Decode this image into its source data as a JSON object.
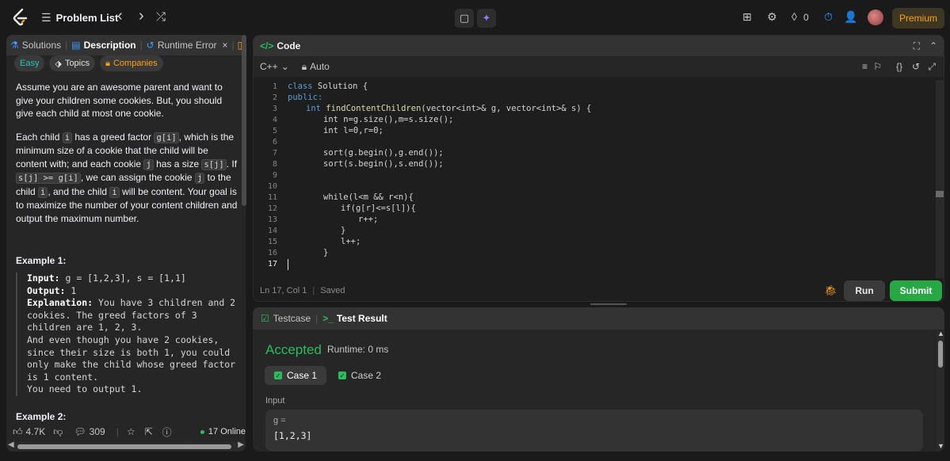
{
  "topbar": {
    "problem_list": "Problem List",
    "prev": "‹",
    "next": "›",
    "shuffle": "⤮",
    "streak_count": "0",
    "premium": "Premium"
  },
  "left": {
    "tabs": {
      "solutions": "Solutions",
      "description": "Description",
      "runtime_error": "Runtime Error",
      "close": "×"
    },
    "tags": {
      "difficulty": "Easy",
      "topics": "Topics",
      "companies": "Companies"
    },
    "desc_p1": "Assume you are an awesome parent and want to give your children some cookies. But, you should give each child at most one cookie.",
    "desc_p2": {
      "t1": "Each child ",
      "c1": "i",
      "t2": " has a greed factor ",
      "c2": "g[i]",
      "t3": ", which is the minimum size of a cookie that the child will be content with; and each cookie ",
      "c3": "j",
      "t4": " has a size ",
      "c4": "s[j]",
      "t5": ". If ",
      "c5": "s[j] >= g[i]",
      "t6": ", we can assign the cookie ",
      "c6": "j",
      "t7": " to the child ",
      "c7": "i",
      "t8": ", and the child ",
      "c8": "i",
      "t9": " will be content. Your goal is to maximize the number of your content children and output the maximum number."
    },
    "example1_title": "Example 1:",
    "example1": {
      "input_label": "Input:",
      "input_value": " g = [1,2,3], s = [1,1]",
      "output_label": "Output:",
      "output_value": " 1",
      "explanation_label": "Explanation:",
      "explanation_value": " You have 3 children and 2 cookies. The greed factors of 3 children are 1, 2, 3.\nAnd even though you have 2 cookies, since their size is both 1, you could only make the child whose greed factor is 1 content.\nYou need to output 1."
    },
    "example2_title": "Example 2:",
    "footer": {
      "likes": "4.7K",
      "comments": "309",
      "online": "17 Online"
    }
  },
  "code": {
    "title": "Code",
    "language": "C++",
    "mode": "Auto",
    "lines": [
      {
        "n": "1"
      },
      {
        "n": "2"
      },
      {
        "n": "3"
      },
      {
        "n": "4"
      },
      {
        "n": "5"
      },
      {
        "n": "6"
      },
      {
        "n": "7"
      },
      {
        "n": "8"
      },
      {
        "n": "9"
      },
      {
        "n": "10"
      },
      {
        "n": "11"
      },
      {
        "n": "12"
      },
      {
        "n": "13"
      },
      {
        "n": "14"
      },
      {
        "n": "15"
      },
      {
        "n": "16"
      },
      {
        "n": "17"
      }
    ],
    "code_text": {
      "l1_kw": "class",
      "l1_rest": " Solution {",
      "l2": "public:",
      "l3_kw": "int",
      "l3_fn": " findContentChildren",
      "l3_rest": "(vector<int>& g, vector<int>& s) {",
      "l4": "int n=g.size(),m=s.size();",
      "l5": "int l=0,r=0;",
      "l7": "sort(g.begin(),g.end());",
      "l8": "sort(s.begin(),s.end());",
      "l11": "while(l<m && r<n){",
      "l12": "if(g[r]<=s[l]){",
      "l13": "r++;",
      "l14": "}",
      "l15": "l++;",
      "l16": "}"
    },
    "status": "Ln 17, Col 1",
    "saved": "Saved",
    "run": "Run",
    "submit": "Submit"
  },
  "result": {
    "testcase_tab": "Testcase",
    "result_tab": "Test Result",
    "verdict": "Accepted",
    "runtime": "Runtime: 0 ms",
    "case1": "Case 1",
    "case2": "Case 2",
    "input_label": "Input",
    "var_name": "g =",
    "var_value": "[1,2,3]"
  },
  "colors": {
    "accent": "#ffa116",
    "success": "#2cbb5d",
    "easy": "#27c3b2"
  }
}
